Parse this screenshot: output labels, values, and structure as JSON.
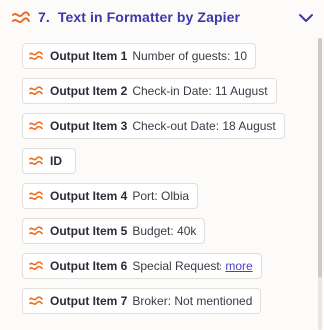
{
  "header": {
    "step_number": "7.",
    "title": "Text in Formatter by Zapier",
    "accent_color": "#3d3aa8",
    "icon": "formatter-icon",
    "toggle_icon": "chevron-down-icon"
  },
  "items": [
    {
      "label": "Output Item 1",
      "value": "Number of guests: 10"
    },
    {
      "label": "Output Item 2",
      "value": "Check-in Date: 11 August"
    },
    {
      "label": "Output Item 3",
      "value": "Check-out Date: 18 August"
    },
    {
      "label": "ID",
      "value": ""
    },
    {
      "label": "Output Item 4",
      "value": "Port: Olbia"
    },
    {
      "label": "Output Item 5",
      "value": "Budget: 40k"
    },
    {
      "label": "Output Item 6",
      "value": "Special Requests: Not m",
      "more_label": "more"
    },
    {
      "label": "Output Item 7",
      "value": "Broker: Not mentioned"
    }
  ],
  "item_icon": "formatter-icon",
  "icon_color": "#f06a1e",
  "link_color": "#4b3fd1"
}
